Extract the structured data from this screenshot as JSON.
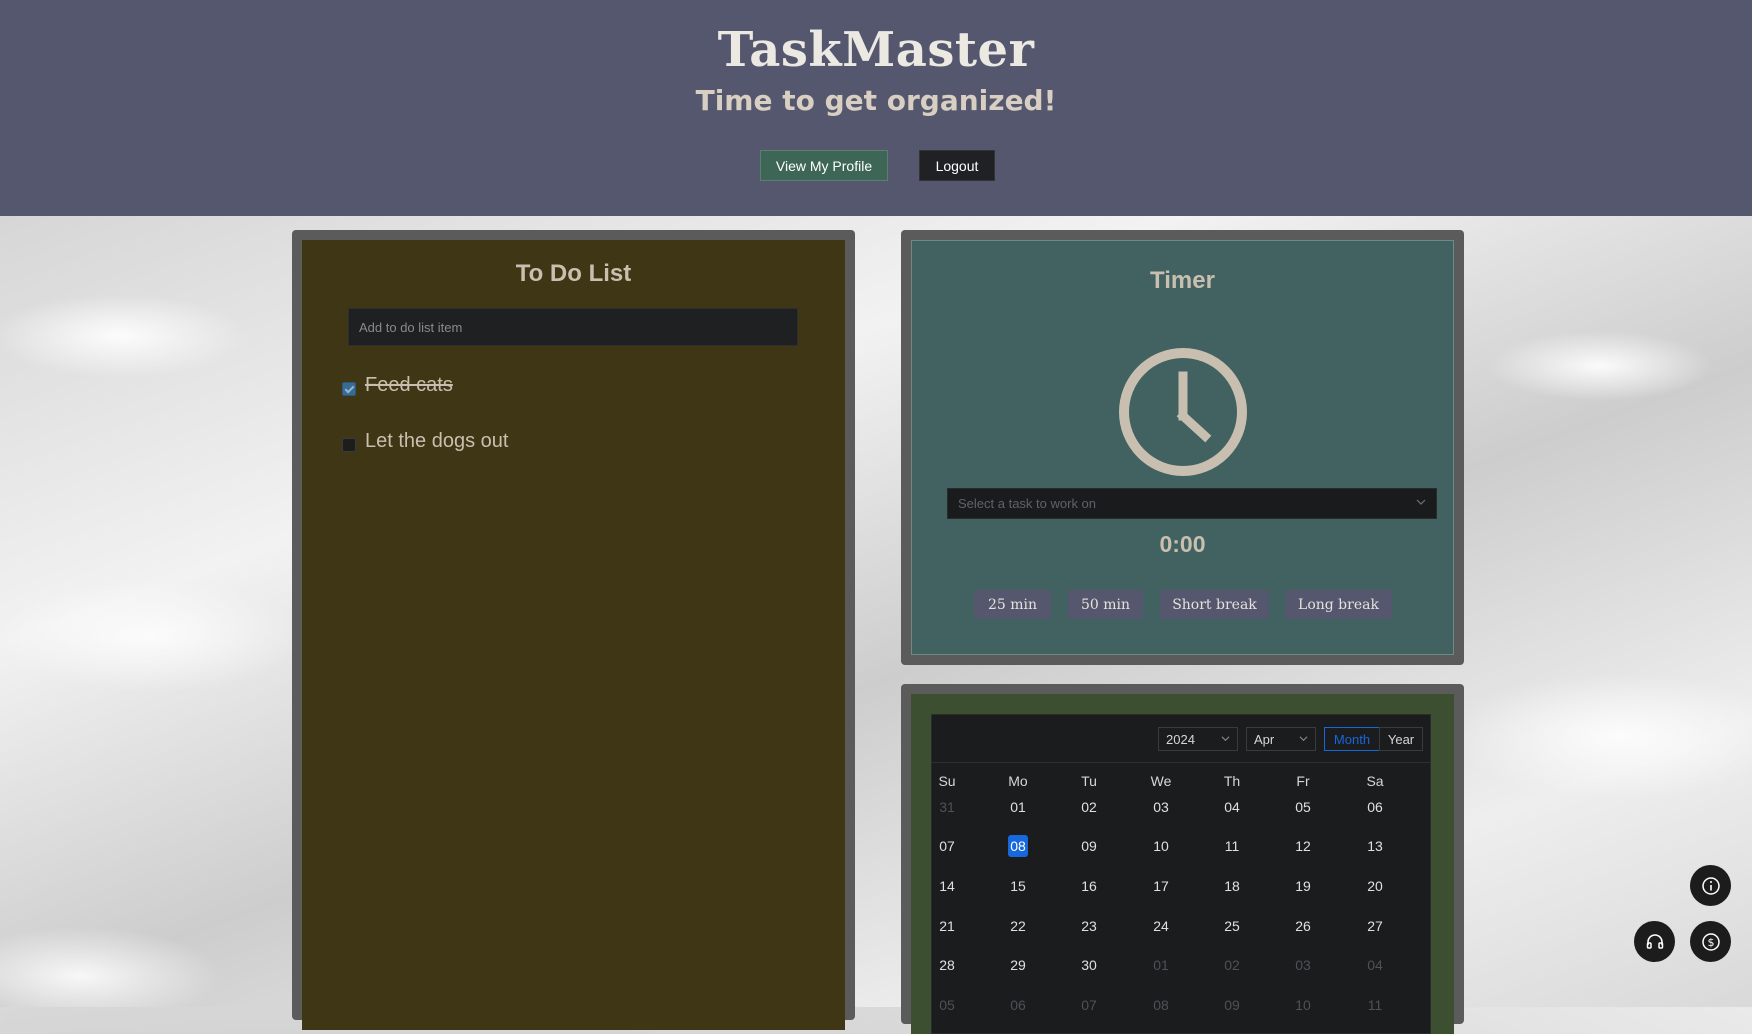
{
  "header": {
    "title": "TaskMaster",
    "subtitle": "Time to get organized!",
    "profile_button": "View My Profile",
    "logout_button": "Logout"
  },
  "todo": {
    "title": "To Do List",
    "input_placeholder": "Add to do list item",
    "items": [
      {
        "label": "Feed cats",
        "done": true
      },
      {
        "label": "Let the dogs out",
        "done": false
      }
    ]
  },
  "timer": {
    "title": "Timer",
    "icon": "clock-icon",
    "task_select_placeholder": "Select a task to work on",
    "display": "0:00",
    "buttons": [
      "25 min",
      "50 min",
      "Short break",
      "Long break"
    ]
  },
  "calendar": {
    "year": "2024",
    "month": "Apr",
    "mode_month": "Month",
    "mode_year": "Year",
    "weekdays": [
      "Su",
      "Mo",
      "Tu",
      "We",
      "Th",
      "Fr",
      "Sa"
    ],
    "selected_day": "08",
    "weeks": [
      [
        "31",
        "01",
        "02",
        "03",
        "04",
        "05",
        "06"
      ],
      [
        "07",
        "08",
        "09",
        "10",
        "11",
        "12",
        "13"
      ],
      [
        "14",
        "15",
        "16",
        "17",
        "18",
        "19",
        "20"
      ],
      [
        "21",
        "22",
        "23",
        "24",
        "25",
        "26",
        "27"
      ],
      [
        "28",
        "29",
        "30",
        "01",
        "02",
        "03",
        "04"
      ],
      [
        "05",
        "06",
        "07",
        "08",
        "09",
        "10",
        "11"
      ]
    ],
    "muted": [
      [
        0,
        0
      ],
      [
        4,
        3
      ],
      [
        4,
        4
      ],
      [
        4,
        5
      ],
      [
        4,
        6
      ],
      [
        5,
        0
      ],
      [
        5,
        1
      ],
      [
        5,
        2
      ],
      [
        5,
        3
      ],
      [
        5,
        4
      ],
      [
        5,
        5
      ],
      [
        5,
        6
      ]
    ]
  },
  "floating_buttons": [
    "info-icon",
    "headphones-icon",
    "dollar-icon"
  ],
  "colors": {
    "header_bg": "#55576e",
    "todo_bg": "#3e3614",
    "timer_bg": "#416261",
    "calendar_panel_bg": "#3d4f31",
    "accent_blue": "#1668dc",
    "profile_button_bg": "#3d6657"
  }
}
